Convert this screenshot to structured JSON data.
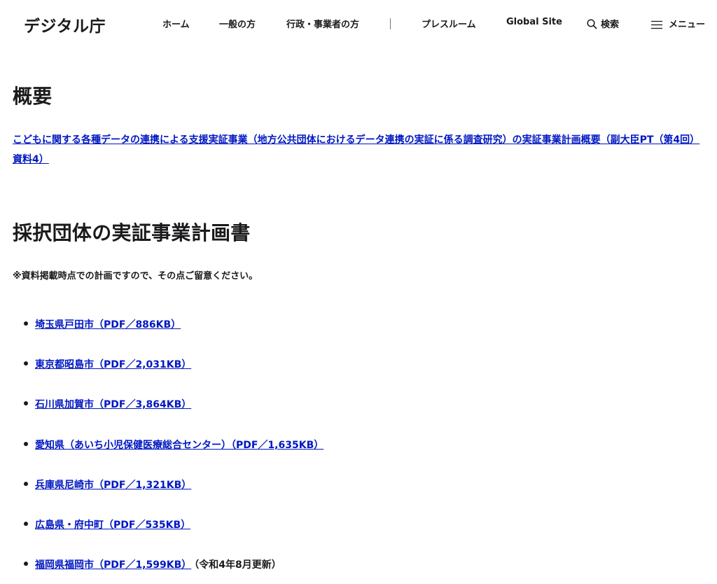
{
  "header": {
    "logo": "デジタル庁",
    "nav": {
      "home": "ホーム",
      "general": "一般の方",
      "business": "行政・事業者の方",
      "press": "プレスルーム",
      "global": "Global Site",
      "search": "検索",
      "menu": "メニュー"
    },
    "icons": {
      "search": "search-icon",
      "menu": "hamburger-icon"
    }
  },
  "summary": {
    "heading": "概要",
    "link": "こどもに関する各種データの連携による支援実証事業（地方公共団体におけるデータ連携の実証に係る調査研究）の実証事業計画概要（副大臣PT（第4回）資料4）"
  },
  "plans": {
    "heading": "採択団体の実証事業計画書",
    "note": "※資料掲載時点での計画ですので、その点ご留意ください。",
    "items": [
      {
        "label": "埼玉県戸田市（PDF／886KB）",
        "extra": ""
      },
      {
        "label": "東京都昭島市（PDF／2,031KB）",
        "extra": ""
      },
      {
        "label": "石川県加賀市（PDF／3,864KB）",
        "extra": ""
      },
      {
        "label": "愛知県（あいち小児保健医療総合センター）（PDF／1,635KB）",
        "extra": ""
      },
      {
        "label": "兵庫県尼崎市（PDF／1,321KB）",
        "extra": ""
      },
      {
        "label": "広島県・府中町（PDF／535KB）",
        "extra": ""
      },
      {
        "label": "福岡県福岡市（PDF／1,599KB）",
        "extra": "（令和4年8月更新）"
      }
    ]
  },
  "colors": {
    "link": "#0017c1",
    "text": "#1a1a1c",
    "background": "#ffffff"
  }
}
